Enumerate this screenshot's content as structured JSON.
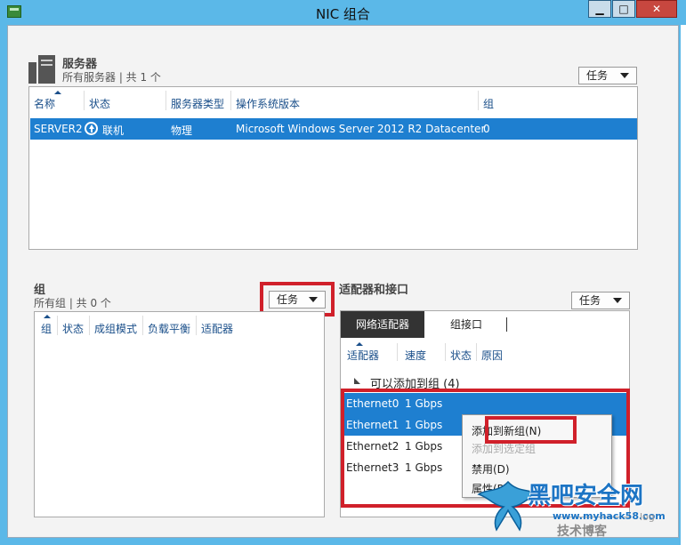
{
  "window": {
    "title": "NIC 组合",
    "min_glyph": "▁",
    "max_glyph": "□",
    "close_glyph": "✕"
  },
  "servers": {
    "title": "服务器",
    "subtitle": "所有服务器 | 共 1 个",
    "tasks_label": "任务",
    "columns": [
      "名称",
      "状态",
      "服务器类型",
      "操作系统版本",
      "组"
    ],
    "rows": [
      {
        "name": "SERVER2",
        "status": "联机",
        "type": "物理",
        "os": "Microsoft Windows Server 2012 R2 Datacenter",
        "group": "0"
      }
    ]
  },
  "teams": {
    "title": "组",
    "subtitle": "所有组 | 共 0 个",
    "tasks_label": "任务",
    "columns": [
      "组",
      "状态",
      "成组模式",
      "负载平衡",
      "适配器"
    ]
  },
  "adapters": {
    "title": "适配器和接口",
    "tasks_label": "任务",
    "tabs": [
      "网络适配器",
      "组接口"
    ],
    "columns": [
      "适配器",
      "速度",
      "状态",
      "原因"
    ],
    "group_label": "可以添加到组 (4)",
    "rows": [
      {
        "name": "Ethernet0",
        "speed": "1 Gbps"
      },
      {
        "name": "Ethernet1",
        "speed": "1 Gbps"
      },
      {
        "name": "Ethernet2",
        "speed": "1 Gbps"
      },
      {
        "name": "Ethernet3",
        "speed": "1 Gbps"
      }
    ]
  },
  "context_menu": {
    "items": [
      "添加到新组(N)",
      "添加到选定组",
      "禁用(D)",
      "属性(P)"
    ]
  },
  "watermark": {
    "brand": "黑吧安全网",
    "url": "www.myhack58.com",
    "tag": "技术博客",
    "suffix": "log"
  },
  "colors": {
    "titlebar": "#5bb8e8",
    "selection": "#1e7fd0",
    "highlight_red": "#d0202a",
    "column_header": "#1a4f8a"
  }
}
